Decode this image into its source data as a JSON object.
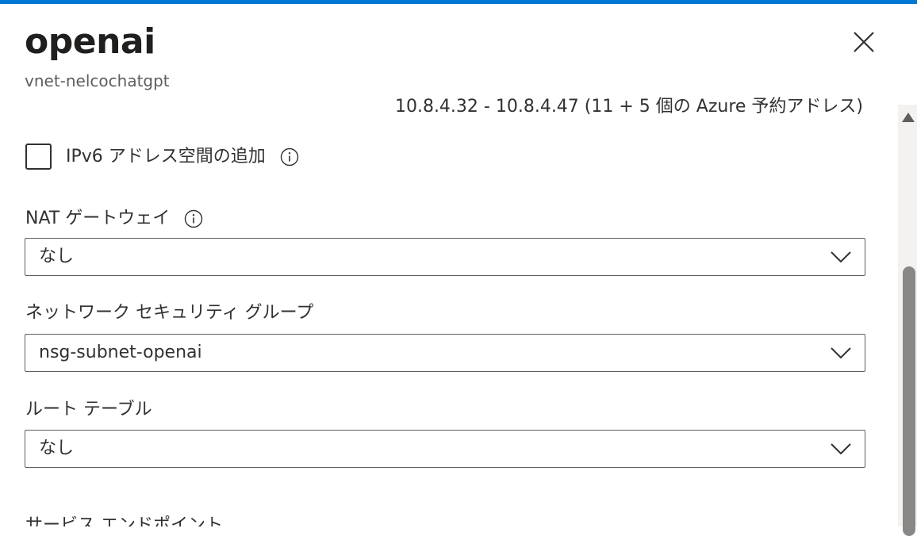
{
  "panel": {
    "title": "openai",
    "subtitle": "vnet-nelcochatgpt"
  },
  "address_range": "10.8.4.32 - 10.8.4.47 (11 + 5 個の Azure 予約アドレス)",
  "ipv6": {
    "label": "IPv6 アドレス空間の追加",
    "checked": false
  },
  "nat_gateway": {
    "label": "NAT ゲートウェイ",
    "value": "なし"
  },
  "nsg": {
    "label": "ネットワーク セキュリティ グループ",
    "value": "nsg-subnet-openai"
  },
  "route_table": {
    "label": "ルート テーブル",
    "value": "なし"
  },
  "next_section": {
    "label": "サービス エンドポイント"
  },
  "colors": {
    "accent": "#0078d4",
    "text": "#323130",
    "border": "#605e5c",
    "scrollbar_thumb": "#8a8886"
  },
  "icons": [
    "close-icon",
    "info-icon",
    "chevron-down-icon",
    "scroll-up-arrow-icon"
  ]
}
